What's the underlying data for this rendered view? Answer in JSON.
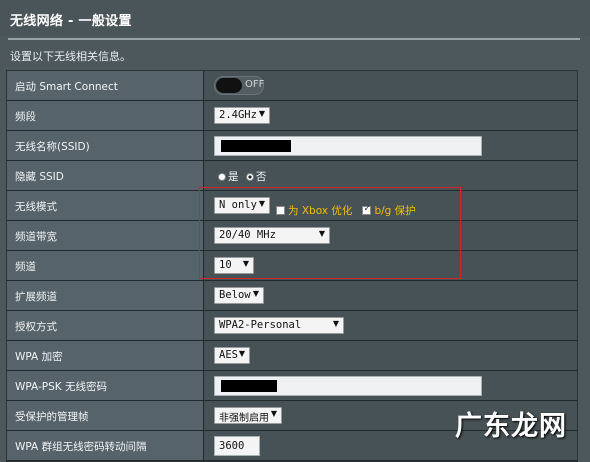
{
  "header": {
    "title": "无线网络 - 一般设置"
  },
  "description": "设置以下无线相关信息。",
  "rows": {
    "smart_connect": {
      "label": "启动 Smart Connect",
      "toggle_state": "OFF"
    },
    "band": {
      "label": "频段",
      "value": "2.4GHz"
    },
    "ssid": {
      "label": "无线名称(SSID)",
      "value_redacted": true
    },
    "hide_ssid": {
      "label": "隐藏 SSID",
      "yes": "是",
      "no": "否",
      "selected": "否"
    },
    "wireless_mode": {
      "label": "无线模式",
      "value": "N only",
      "xbox": "为 Xbox 优化",
      "bg": "b/g 保护",
      "xbox_checked": false,
      "bg_checked": true
    },
    "bandwidth": {
      "label": "频道带宽",
      "value": "20/40 MHz"
    },
    "channel": {
      "label": "频道",
      "value": "10"
    },
    "ext_channel": {
      "label": "扩展频道",
      "value": "Below"
    },
    "auth": {
      "label": "授权方式",
      "value": "WPA2-Personal"
    },
    "wpa_enc": {
      "label": "WPA 加密",
      "value": "AES"
    },
    "psk": {
      "label": "WPA-PSK 无线密码",
      "value_redacted": true
    },
    "pmf": {
      "label": "受保护的管理帧",
      "value": "非强制启用"
    },
    "gtk": {
      "label": "WPA 群组无线密码转动间隔",
      "value": "3600"
    }
  },
  "watermark": "广东龙网",
  "colors": {
    "highlight_box": "#d8202a",
    "option_text": "#f0c000"
  }
}
